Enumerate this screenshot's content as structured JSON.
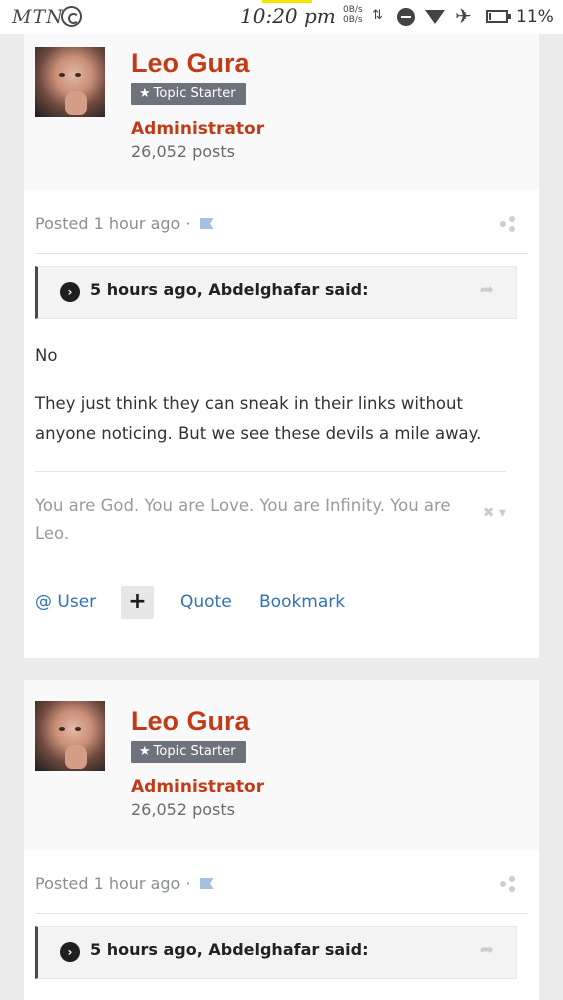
{
  "status_bar": {
    "carrier": "MTN",
    "time": "10:20 pm",
    "speed_up": "0B/s",
    "speed_down": "0B/s",
    "battery_percent": "11%",
    "battery_level": 0.11,
    "icons": [
      "whatsapp-icon",
      "data-arrows-icon",
      "do-not-disturb-icon",
      "wifi-icon",
      "airplane-icon",
      "battery-icon"
    ]
  },
  "posts": [
    {
      "author": {
        "name": "Leo Gura",
        "badge": "Topic Starter",
        "role": "Administrator",
        "post_count": "26,052 posts"
      },
      "posted": "Posted 1 hour ago ·",
      "quote": {
        "text": "5 hours ago, Abdelghafar said:"
      },
      "body": [
        "No",
        "They just think they can sneak in their links without anyone noticing. But we see these devils a mile away."
      ],
      "signature": "You are God. You are Love. You are Infinity. You are Leo.",
      "actions": {
        "user": "@ User",
        "plus": "+",
        "quote": "Quote",
        "bookmark": "Bookmark"
      }
    },
    {
      "author": {
        "name": "Leo Gura",
        "badge": "Topic Starter",
        "role": "Administrator",
        "post_count": "26,052 posts"
      },
      "posted": "Posted 1 hour ago ·",
      "quote": {
        "text": "5 hours ago, Abdelghafar said:"
      }
    }
  ],
  "colors": {
    "accent": "#c03b16",
    "link": "#2f72b5",
    "badge_bg": "#6d737a",
    "page_bg": "#ebebeb"
  }
}
